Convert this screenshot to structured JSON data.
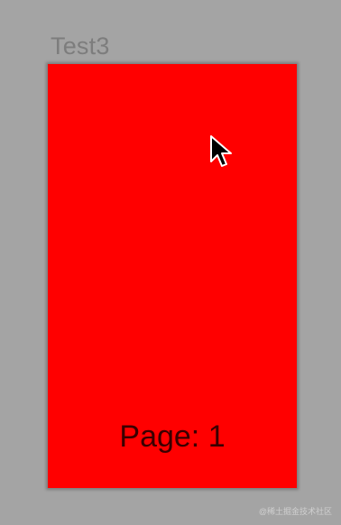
{
  "app": {
    "title": "Test3"
  },
  "page": {
    "label": "Page: 1",
    "background_color": "#ff0000"
  },
  "cursor": {
    "icon": "mouse-pointer-icon"
  },
  "watermark": {
    "text": "@稀土掘金技术社区"
  },
  "colors": {
    "canvas": "#a4a4a4",
    "title": "#7d7d7d",
    "page_text": "#3a0000"
  }
}
